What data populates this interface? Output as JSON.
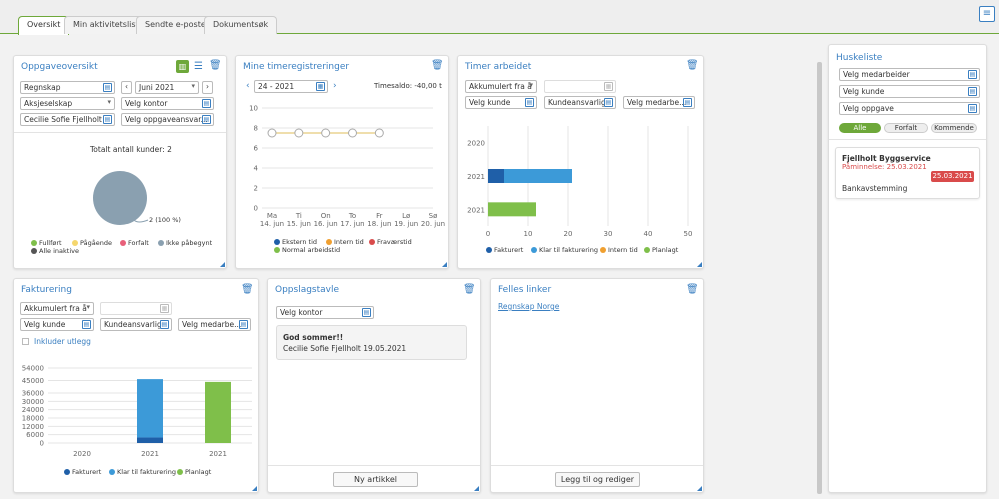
{
  "tabs": [
    {
      "label": "Oversikt",
      "active": true
    },
    {
      "label": "Min aktivitetsliste",
      "active": false
    },
    {
      "label": "Sendte e-poster",
      "active": false
    },
    {
      "label": "Dokumentsøk",
      "active": false
    }
  ],
  "colors": {
    "accent": "#3a7fc1",
    "green": "#6ea83a",
    "fakturert": "#1f5fa8",
    "klar": "#3c9ad8",
    "intern": "#f0a030",
    "planlagt": "#7fbf4a",
    "danger": "#d94b4b"
  },
  "oppgave": {
    "title": "Oppgaveoversikt",
    "company": "Regnskap",
    "month": "Juni 2021",
    "type": "Aksjeselskap",
    "office": "Velg kontor",
    "person": "Cecilie Sofie Fjellholt",
    "responsible": "Velg oppgaveansvar...",
    "total": "Totalt antall kunder: 2",
    "pie_label": "2 (100 %)",
    "legend": [
      "Fullført",
      "Pågående",
      "Forfalt",
      "Ikke påbegynt",
      "Alle inaktive"
    ]
  },
  "timer": {
    "title": "Mine timeregistreringer",
    "week": "24 - 2021",
    "saldo": "Timesaldo: -40,00 t",
    "days": [
      "Ma",
      "Ti",
      "On",
      "To",
      "Fr",
      "Lø",
      "Sø"
    ],
    "dates": [
      "14. jun",
      "15. jun",
      "16. jun",
      "17. jun",
      "18. jun",
      "19. jun",
      "20. jun"
    ],
    "legend": [
      "Ekstern tid",
      "Intern tid",
      "Fraværstid",
      "Normal arbeidstid"
    ]
  },
  "arbeidet": {
    "title": "Timer arbeidet",
    "period": "Akkumulert fra å",
    "customer": "Velg kunde",
    "responsible": "Kundeansvarlig",
    "employee": "Velg medarbe...",
    "legend": [
      "Fakturert",
      "Klar til fakturering",
      "Intern tid",
      "Planlagt"
    ]
  },
  "fakturering": {
    "title": "Fakturering",
    "period": "Akkumulert fra å",
    "customer": "Velg kunde",
    "responsible": "Kundeansvarlig",
    "employee": "Velg medarbe...",
    "include": "Inkluder utlegg",
    "legend": [
      "Fakturert",
      "Klar til fakturering",
      "Planlagt"
    ]
  },
  "oppslag": {
    "title": "Oppslagstavle",
    "office": "Velg kontor",
    "note_title": "God sommer!!",
    "note_meta": "Cecilie Sofie Fjellholt 19.05.2021",
    "button": "Ny artikkel"
  },
  "linker": {
    "title": "Felles linker",
    "link": "Regnskap Norge",
    "button": "Legg til og rediger"
  },
  "huskeliste": {
    "title": "Huskeliste",
    "employee": "Velg medarbeider",
    "customer": "Velg kunde",
    "task": "Velg oppgave",
    "filters": [
      "Alle",
      "Forfalt",
      "Kommende"
    ],
    "card_title": "Fjellholt Byggservice",
    "reminder": "Påminnelse: 25.03.2021",
    "date_badge": "25.03.2021",
    "task_name": "Bankavstemming"
  },
  "chart_data": [
    {
      "type": "line",
      "title": "Mine timeregistreringer",
      "categories": [
        "Ma 14. jun",
        "Ti 15. jun",
        "On 16. jun",
        "To 17. jun",
        "Fr 18. jun",
        "Lø 19. jun",
        "Sø 20. jun"
      ],
      "series": [
        {
          "name": "Normal arbeidstid",
          "values": [
            7.5,
            7.5,
            7.5,
            7.5,
            7.5,
            null,
            null
          ]
        }
      ],
      "ylim": [
        0,
        10
      ],
      "yticks": [
        0,
        2,
        4,
        6,
        8,
        10
      ]
    },
    {
      "type": "bar",
      "orientation": "horizontal",
      "title": "Timer arbeidet",
      "categories": [
        "2020",
        "2021",
        "2021"
      ],
      "series": [
        {
          "name": "Fakturert",
          "values": [
            0,
            4,
            0
          ]
        },
        {
          "name": "Klar til fakturering",
          "values": [
            0,
            17,
            0
          ]
        },
        {
          "name": "Planlagt",
          "values": [
            0,
            0,
            12
          ]
        }
      ],
      "xlim": [
        0,
        50
      ],
      "xticks": [
        0,
        10,
        20,
        30,
        40,
        50
      ]
    },
    {
      "type": "bar",
      "title": "Fakturering",
      "categories": [
        "2020",
        "2021",
        "2021"
      ],
      "series": [
        {
          "name": "Fakturert",
          "values": [
            0,
            4000,
            0
          ]
        },
        {
          "name": "Klar til fakturering",
          "values": [
            0,
            42000,
            0
          ]
        },
        {
          "name": "Planlagt",
          "values": [
            0,
            0,
            44000
          ]
        }
      ],
      "ylim": [
        0,
        54000
      ],
      "yticks": [
        0,
        6000,
        12000,
        18000,
        24000,
        30000,
        36000,
        45000,
        54000
      ],
      "ytick_labels": [
        "0",
        "6000",
        "12000",
        "18000",
        "24000",
        "30000",
        "36000",
        "45000",
        "54000"
      ]
    }
  ]
}
